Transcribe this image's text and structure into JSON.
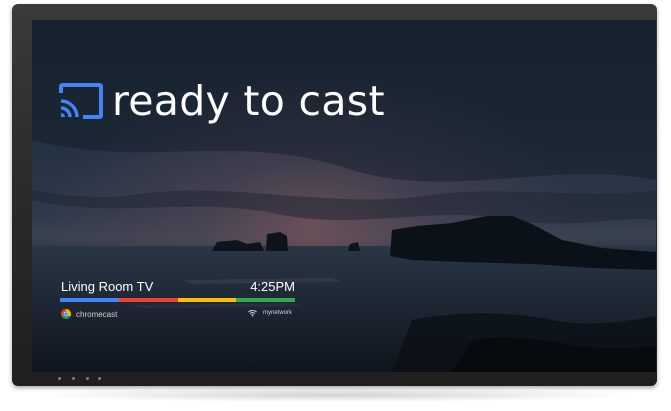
{
  "headline": {
    "text": "ready to cast",
    "icon": "cast-icon",
    "icon_color": "#4285f4"
  },
  "device": {
    "name": "Living Room TV",
    "time": "4:25PM"
  },
  "color_bar": {
    "colors": [
      "#4285f4",
      "#ea4335",
      "#fbbc05",
      "#34a853"
    ]
  },
  "footer": {
    "brand_label": "chromecast",
    "brand_icon": "chrome-icon",
    "network_label": "mynetwork",
    "network_icon": "wifi-icon"
  }
}
